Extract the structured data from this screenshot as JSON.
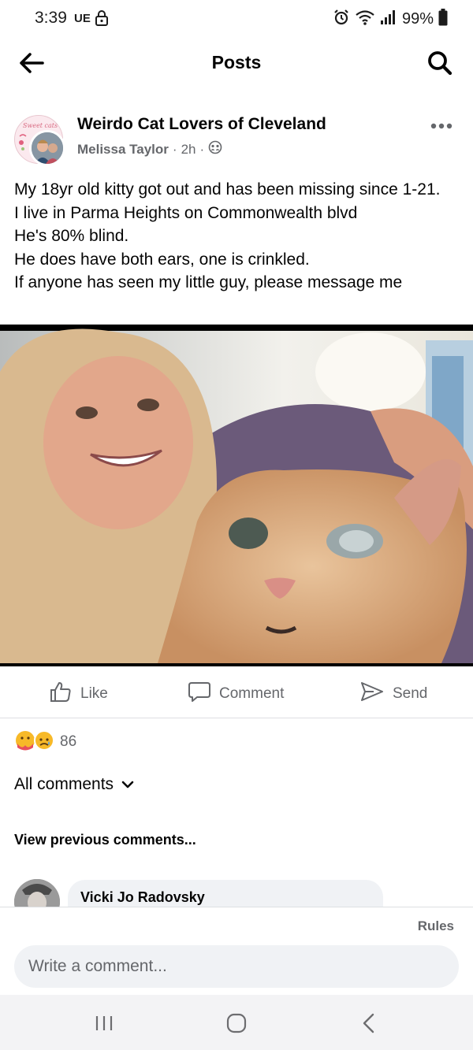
{
  "status_bar": {
    "time": "3:39",
    "carrier": "UE",
    "battery": "99%"
  },
  "header": {
    "title": "Posts"
  },
  "post": {
    "group_name": "Weirdo Cat Lovers of Cleveland",
    "group_avatar_text": "Sweet cats",
    "author": "Melissa Taylor",
    "time": "2h",
    "separator": "·",
    "lines": [
      "My 18yr old kitty got out and has been missing since 1-21.",
      "I live in Parma Heights on Commonwealth blvd",
      "He's 80% blind.",
      "He does have both ears, one is crinkled.",
      "If anyone has seen my little guy, please message me"
    ]
  },
  "actions": {
    "like": "Like",
    "comment": "Comment",
    "send": "Send"
  },
  "reactions": {
    "count": "86"
  },
  "comments": {
    "filter_label": "All comments",
    "view_previous": "View previous comments...",
    "first_commenter": "Vicki Jo Radovsky"
  },
  "composer": {
    "rules": "Rules",
    "placeholder": "Write a comment..."
  },
  "colors": {
    "secondary_text": "#65676b",
    "input_bg": "#f0f2f5",
    "nav_bg": "#f3f3f5"
  }
}
